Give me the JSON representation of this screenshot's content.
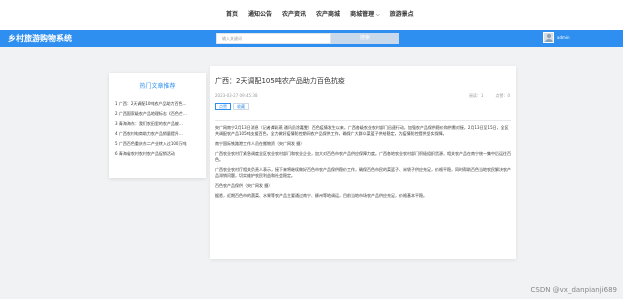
{
  "topnav": {
    "items": [
      {
        "label": "首页"
      },
      {
        "label": "通知公告"
      },
      {
        "label": "农产资讯"
      },
      {
        "label": "农产商城"
      },
      {
        "label": "商城管理"
      },
      {
        "label": "旅游景点"
      }
    ]
  },
  "header": {
    "brand": "乡村旅游购物系统",
    "search_placeholder": "输入关键词",
    "search_button": "搜索",
    "username": "admin"
  },
  "sidebar": {
    "title": "热门文章推荐",
    "items": [
      "1 广西：2天调配10吨农产品助力百色…",
      "2 广西国家级农产品地理标志《百色芒…",
      "3 青海海东：我们农田里的农产品被…",
      "4 广西农村电商助力农产品销量提升…",
      "5 广西百色重庆东二产业转入过100万吨",
      "6 青海省农村农村农产品促销活动"
    ]
  },
  "article": {
    "title": "广西：2天调配105吨农产品助力百色抗疫",
    "meta": "2023-03-27 09:45:38",
    "stats": [
      "阅读：1",
      "点赞：0"
    ],
    "like_label": "点赞",
    "fav_label": "收藏",
    "paragraphs": [
      "央广网南宁2月13日消息（记者谭彩燕 通讯员涂嘉雯）百色疫情发生以来，广西各级农业农村部门迅速行动，加强农产品保供稳价和供需对接，2月13日至15日，全区共调配农产品105吨支援百色，全力做好疫情防控期间农产品保供工作，确保广大群众菜篮子供给稳定，为疫情防控提供坚实保障。",
      "南宁国际铁路港工作人员在搬物资（央广网发 摄）",
      "广西农业农村厅紧急调度全区农业农村部门和农业企业，加大对百色市农产品供应保障力度。广西各地农业农村部门积极组织货源，相关农产品在南宁统一集中后运往百色。",
      "广西农业农村厅相关负责人表示，接下来将继续做好百色市农产品保供稳价工作，确保百色市民的菜篮子、米袋子供应充足，价格平稳，同时帮助百色当地农民解决农产品滞销问题，切实维护农民利益和社会稳定。",
      "百色农产品保供（央广网发 摄）",
      "据悉，近期百色市的蔬菜、水果等农产品主要通过南宁、柳州等地调运，目前当地市场农产品供应充足，价格基本平稳。"
    ]
  },
  "watermark": "CSDN @vx_danpianji689",
  "colors": {
    "brand_blue": "#2f8ff0",
    "page_bg": "#f1f2f4"
  }
}
